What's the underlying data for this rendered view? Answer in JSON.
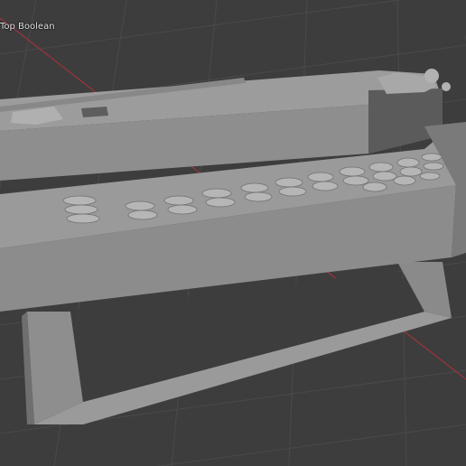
{
  "viewport": {
    "object_label": "Top Boolean"
  },
  "colors": {
    "background": "#3d3d3d",
    "grid_line": "#4a4a4a",
    "x_axis": "#a0323c",
    "model_top": "#9c9c9c",
    "model_front": "#8e8e8e",
    "model_dark": "#5b5b5b",
    "model_keys": "#b6b6b6"
  }
}
